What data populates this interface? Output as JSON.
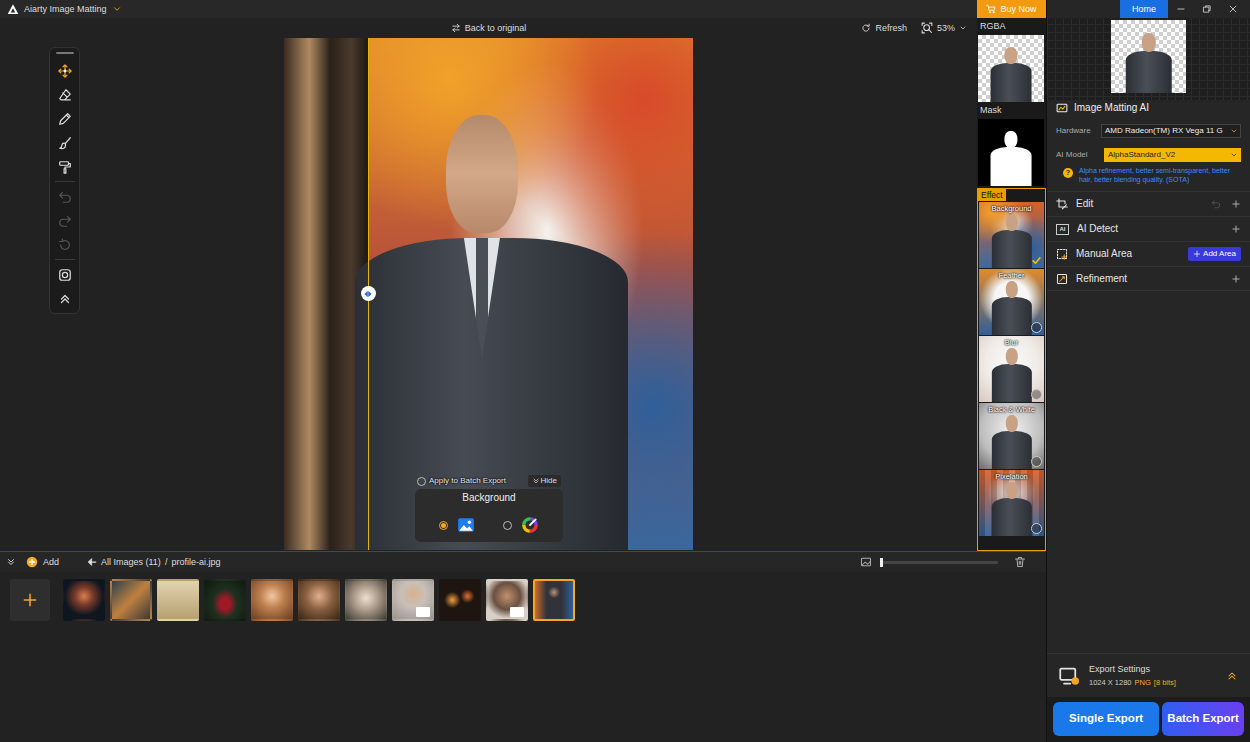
{
  "window": {
    "title": "Aiarty Image Matting"
  },
  "buy_now": "Buy Now",
  "home": {
    "label": "Home",
    "selected": true
  },
  "canvas_toolbar": {
    "back": "Back to original",
    "refresh": "Refresh",
    "zoom": "53%"
  },
  "tools": [
    {
      "kind": "move",
      "selected": true,
      "disabled": false
    },
    {
      "kind": "eraser",
      "selected": false,
      "disabled": false
    },
    {
      "kind": "restore",
      "selected": false,
      "disabled": false
    },
    {
      "kind": "brush",
      "selected": false,
      "disabled": false
    },
    {
      "kind": "roller",
      "selected": false,
      "disabled": false
    },
    {
      "kind": "undo",
      "selected": false,
      "disabled": true
    },
    {
      "kind": "redo",
      "selected": false,
      "disabled": true
    },
    {
      "kind": "reset",
      "selected": false,
      "disabled": true
    },
    {
      "kind": "fit",
      "selected": false,
      "disabled": false
    },
    {
      "kind": "collapse",
      "selected": false,
      "disabled": false
    }
  ],
  "split": {
    "level": 0.205
  },
  "background_popup": {
    "apply": {
      "label": "Apply to Batch Export",
      "checked": false
    },
    "hide": "Hide",
    "title": "Background",
    "options": [
      {
        "kind": "image",
        "selected": true
      },
      {
        "kind": "color",
        "selected": false
      }
    ]
  },
  "preview_strip": {
    "rgba": "RGBA",
    "mask": "Mask",
    "effect": "Effect",
    "effects": [
      {
        "label": "Background",
        "selected": true
      },
      {
        "label": "Feather",
        "selected": false
      },
      {
        "label": "Blur",
        "selected": false
      },
      {
        "label": "Black & White",
        "selected": false
      },
      {
        "label": "Pixelation",
        "selected": false
      }
    ]
  },
  "panel": {
    "title": "Image Matting AI",
    "hardware": {
      "label": "Hardware",
      "value": "AMD Radeon(TM) RX Vega 11 G"
    },
    "model": {
      "label": "AI Model",
      "value": "AlphaStandard_V2"
    },
    "help": {
      "icon": "?",
      "text": "Alpha refinement, better semi-transparent, better hair, better blending quality. (SOTA)"
    },
    "sections": [
      {
        "label": "Edit",
        "kind": "edit",
        "undo_disabled": true
      },
      {
        "label": "AI Detect",
        "kind": "detect",
        "icon_text": "AI"
      },
      {
        "label": "Manual Area",
        "kind": "manual",
        "button": "Add Area"
      },
      {
        "label": "Refinement",
        "kind": "refine"
      }
    ],
    "export": {
      "title": "Export Settings",
      "size": "1024 X 1280",
      "format": "PNG",
      "bits": "[8 bits]"
    },
    "single_export": "Single Export",
    "batch_export": "Batch Export"
  },
  "filmstrip": {
    "add": "Add",
    "breadcrumb": {
      "root": "All Images (11)",
      "separator": "/",
      "file": "profile-ai.jpg"
    },
    "size_slider": {
      "level": 0.01
    },
    "thumbs": [
      {
        "selected": false,
        "badge": false
      },
      {
        "selected": false,
        "badge": false
      },
      {
        "selected": false,
        "badge": false
      },
      {
        "selected": false,
        "badge": false
      },
      {
        "selected": false,
        "badge": false
      },
      {
        "selected": false,
        "badge": false
      },
      {
        "selected": false,
        "badge": false
      },
      {
        "selected": false,
        "badge": true
      },
      {
        "selected": false,
        "badge": false
      },
      {
        "selected": false,
        "badge": true
      },
      {
        "selected": true,
        "badge": false
      }
    ]
  }
}
